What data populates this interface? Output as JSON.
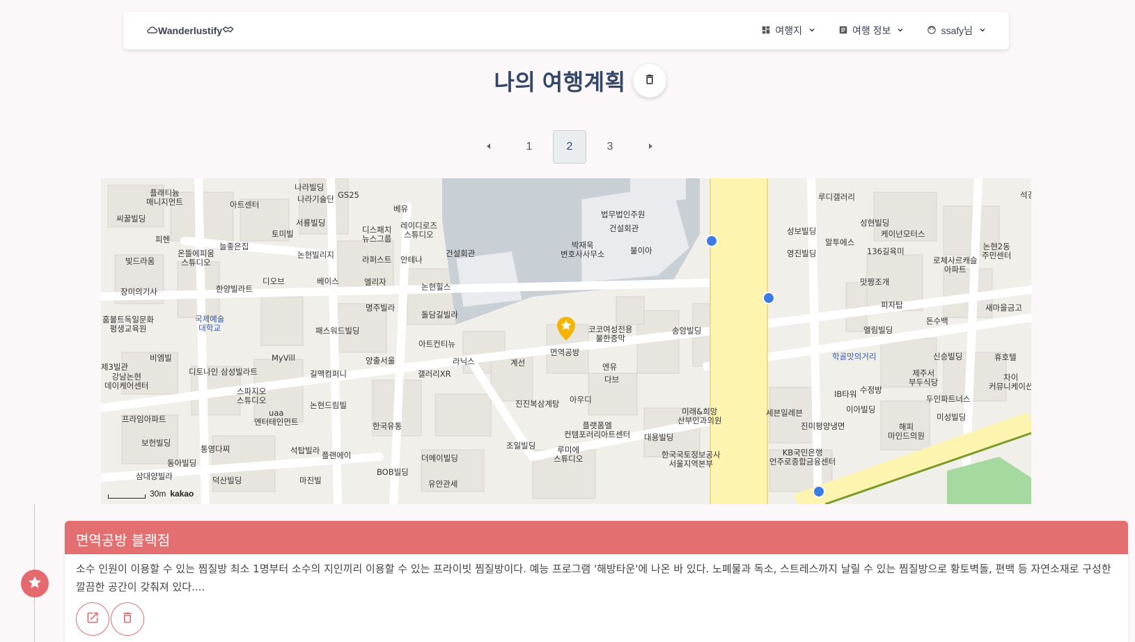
{
  "navbar": {
    "brand": "Wanderlustify",
    "menu": [
      {
        "label": "여행지",
        "icon": "dashboard-icon"
      },
      {
        "label": "여행 정보",
        "icon": "article-icon"
      },
      {
        "label": "ssafy님",
        "icon": "face-icon"
      }
    ]
  },
  "page": {
    "title": "나의 여행계획"
  },
  "pagination": {
    "pages": [
      "1",
      "2",
      "3"
    ],
    "current": "2"
  },
  "map": {
    "labels": [
      "나라빌딩",
      "플래티늄 매니지먼트",
      "나라기술단",
      "GS25",
      "아트센터",
      "씨꿀빌딩",
      "토미빌",
      "서룡빌딩",
      "베유",
      "피헨",
      "늘좋은집",
      "디스패치 뉴스그룹",
      "레이디로즈 스튜디오",
      "법무법인주원",
      "건설회관",
      "성보빌딩",
      "루디갤러리",
      "성현빌딩",
      "케이넌모터스",
      "석경",
      "온뜰에피움 스튜디오",
      "논현빌리지",
      "라퍼스트",
      "안테나",
      "건설회관",
      "박재욱 변호사사무소",
      "불이아",
      "영진빌딩",
      "알투에스",
      "136길육미",
      "논현2동 주민센터",
      "빛드라움",
      "디오브",
      "베이스",
      "엘리자",
      "논현힐스",
      "로체사르캐슬 아파트",
      "장미의기사",
      "한양빌라트",
      "맛짱조개",
      "피자탑",
      "새마을금고",
      "명주빌라",
      "돌담길빌라",
      "돈수백",
      "훔볼트독일문화 평생교육원",
      "국제예술 대학교",
      "패스워드빌딩",
      "코코여성전용 불한증막",
      "송암빌딩",
      "엘림빌딩",
      "아트컨티뉴",
      "면역공방",
      "학골맛의거리",
      "신승빌딩",
      "휴호텔",
      "비엠빌",
      "MyVill",
      "양출서울",
      "라닉스",
      "계선",
      "엔유",
      "제3빌관",
      "강남논현 데이케어센터",
      "디토나인",
      "삼성빌라트",
      "길맥컴퍼니",
      "갤러리XR",
      "다브",
      "제주서 부두식당",
      "차이 커뮤니케이션",
      "IB타워",
      "수정방",
      "스파지오 스튜디오",
      "진진복삼계탕",
      "아우디",
      "두인파트너스",
      "논현드림빌",
      "uaa 엔터테인먼트",
      "한국유통",
      "미래&희망 산부인과의원",
      "세븐일레븐",
      "이아빌딩",
      "미성빌딩",
      "프라임아파트",
      "플랫폼엘 컨템포러리아트센터",
      "진미평양냉면",
      "해피 마인드의원",
      "보헌빌딩",
      "통영다찌",
      "석탑빌라",
      "조일빌딩",
      "대용빌딩",
      "KB국민은행 언주로종합금융센터",
      "플랜에이",
      "루미에 스튜디오",
      "한국국토정보공사 서울지역본부",
      "동아빌딩",
      "더메이빌딩",
      "삼대양빌라",
      "덕산빌딩",
      "BOB빌딩",
      "마진빌",
      "유안관세"
    ],
    "scale": "30m",
    "provider": "kakao"
  },
  "plan": {
    "item_title": "면역공방 블랙점",
    "description": "소수 인원이 이용할 수 있는 찜질방 최소 1명부터 소수의 지인끼리 이용할 수 있는 프라이빗 찜질방이다. 예능 프로그램 '해방타운'에 나온 바 있다. 노폐물과 독소, 스트레스까지 날릴 수 있는 찜질방으로 황토벽돌, 편백 등 자연소재로 구성한 깔끔한 공간이 갖춰져 있다...."
  },
  "colors": {
    "accent": "#e46f71",
    "map_main_road": "#fdf4b0",
    "map_building_block": "#c8d0d6",
    "map_marker": "#f5b400"
  }
}
